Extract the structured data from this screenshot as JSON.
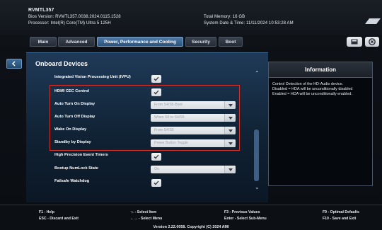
{
  "header": {
    "model": "RVMTL357",
    "bios_version": "Bios Version: RVMTL357.0038.2024.0115.1528",
    "processor": "Processor: Intel(R) Core(TM) Ultra 5 125H",
    "total_memory": "Total Memory: 16 GB",
    "system_date_time": "System Date & Time: 11/11/2024     10:53:28 AM",
    "logo_icon": "asus-logo"
  },
  "tabs": [
    {
      "label": "Main"
    },
    {
      "label": "Advanced"
    },
    {
      "label": "Power, Performance and Cooling"
    },
    {
      "label": "Security"
    },
    {
      "label": "Boot"
    }
  ],
  "toolbar": {
    "save_icon": "save-icon",
    "exit_icon": "exit-icon"
  },
  "panel": {
    "title": "Onboard Devices",
    "rows": [
      {
        "label": "Integrated Vision Processing Unit (IVPU)",
        "type": "checkbox",
        "checked": true
      },
      {
        "label": "HDMI CEC Control",
        "type": "checkbox",
        "checked": true
      },
      {
        "label": "Auto Turn On Display",
        "type": "select",
        "value": "From S4/S5 Boot"
      },
      {
        "label": "Auto Turn Off Display",
        "type": "select",
        "value": "When S0 to S4/S5"
      },
      {
        "label": "Wake On Display",
        "type": "select",
        "value": "From S4/S5"
      },
      {
        "label": "Standby by Display",
        "type": "select",
        "value": "Power Button Toggle"
      },
      {
        "label": "High Precision Event Timers",
        "type": "checkbox",
        "checked": true
      },
      {
        "label": "Bootup NumLock State",
        "type": "select",
        "value": "On"
      },
      {
        "label": "Failsafe Watchdog",
        "type": "checkbox",
        "checked": true
      }
    ]
  },
  "info": {
    "title": "Information",
    "lines": [
      "Control Detection of the HD-Audio device.",
      "Disabled = HDA will be unconditionally disabled",
      "Enabled = HDA will be unconditionally enabled."
    ]
  },
  "footer": {
    "help": "F1 - Help",
    "discard": "ESC - Discard and Exit",
    "select_item": "↑↓ - Select Item",
    "select_menu": "←→ - Select Menu",
    "prev_values": "F3 - Previous Values",
    "select_submenu": "Enter - Select Sub-Menu",
    "optimal": "F9 - Optimal Defaults",
    "save_exit": "F10 - Save and Exit",
    "version": "Version 2.22.0058. Copyright (C) 2024 AMI"
  },
  "colors": {
    "accent": "#2a527c",
    "highlight_box": "#d8322a"
  }
}
